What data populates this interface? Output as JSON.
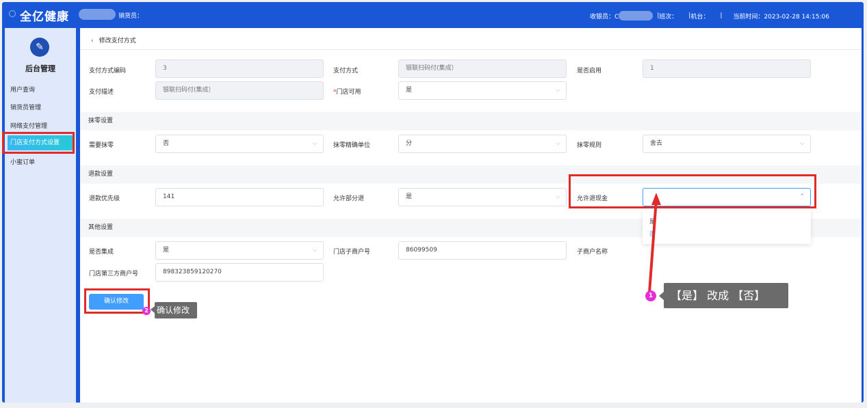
{
  "header": {
    "brand": "全亿健康",
    "seller_label": "销货员：",
    "cashier_label": "收银员：C",
    "shift_label": "班次：",
    "terminal_label": "机台：",
    "current_time": "当前时间：2023-02-28 14:15:06",
    "separator": "|"
  },
  "sidebar": {
    "title": "后台管理",
    "items": [
      {
        "label": "用户查询"
      },
      {
        "label": "销货员管理"
      },
      {
        "label": "网络支付管理"
      },
      {
        "label": "门店支付方式设置"
      },
      {
        "label": "小蜜订单"
      }
    ]
  },
  "page": {
    "back_arrow": "‹",
    "title": "修改支付方式"
  },
  "form": {
    "code_label": "支付方式编码",
    "code_value": "3",
    "method_label": "支付方式",
    "method_value": "银联扫码付(集成）",
    "enabled_label": "是否启用",
    "enabled_value": "1",
    "desc_label": "支付描述",
    "desc_value": "银联扫码付(集成）",
    "store_avail_star": "*",
    "store_avail_label": "门店可用",
    "store_avail_value": "是",
    "rounding_section": "抹零设置",
    "need_round_label": "需要抹零",
    "need_round_value": "否",
    "precision_label": "抹零精确单位",
    "precision_value": "分",
    "rule_label": "抹零规则",
    "rule_value": "舍去",
    "refund_section": "退款设置",
    "refund_priority_label": "退款优先级",
    "refund_priority_value": "141",
    "partial_refund_label": "允许部分退",
    "partial_refund_value": "是",
    "cash_refund_label": "允许退现金",
    "cash_refund_value": "",
    "other_section": "其他设置",
    "integrated_label": "是否集成",
    "integrated_value": "是",
    "sub_merchant_no_label": "门店子商户号",
    "sub_merchant_no_value": "86099509",
    "sub_merchant_name_label": "子商户名称",
    "third_party_label": "门店第三方商户号",
    "third_party_value": "898323859120270"
  },
  "dropdown_options": [
    "是",
    "否"
  ],
  "confirm_button": "确认修改",
  "annotations": {
    "tip1_badge": "1",
    "tip1_text": "【是】 改成 【否】",
    "tip2_badge": "2",
    "tip2_text": "确认修改"
  },
  "colors": {
    "topbar": "#1a57d6",
    "primary_button": "#409eff",
    "highlight_box": "#e02b2b",
    "badge": "#e62ed7"
  }
}
